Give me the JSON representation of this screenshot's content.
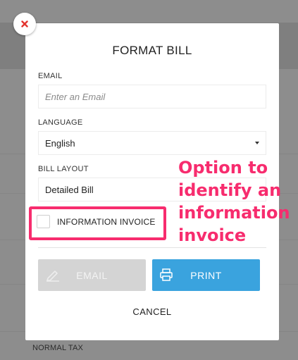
{
  "background": {
    "footer_text": "NORMAL TAX"
  },
  "modal": {
    "title": "FORMAT BILL",
    "close_icon": "close-icon",
    "email": {
      "label": "EMAIL",
      "placeholder": "Enter an Email",
      "value": ""
    },
    "language": {
      "label": "LANGUAGE",
      "selected": "English"
    },
    "bill_layout": {
      "label": "BILL LAYOUT",
      "selected": "Detailed Bill"
    },
    "information_invoice": {
      "label": "INFORMATION INVOICE",
      "checked": false
    },
    "buttons": {
      "email_label": "EMAIL",
      "email_icon": "pen-icon",
      "print_label": "PRINT",
      "print_icon": "printer-icon"
    },
    "cancel_label": "CANCEL"
  },
  "annotation": {
    "text": "Option to\nidentify an\ninformation\ninvoice",
    "color": "#f72c6e"
  },
  "colors": {
    "print_button": "#3aa3de",
    "email_button_disabled": "#d4d4d4",
    "close_icon": "#e3342f"
  }
}
